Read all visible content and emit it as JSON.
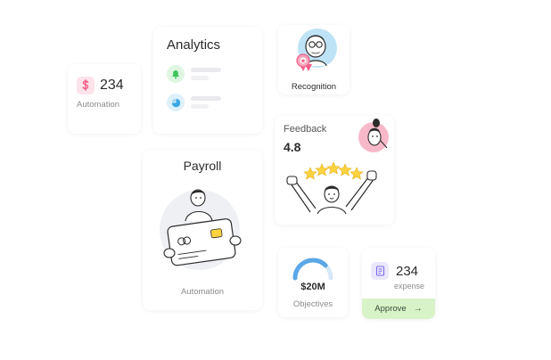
{
  "automation_card": {
    "value": "234",
    "label": "Automation"
  },
  "analytics_card": {
    "title": "Analytics"
  },
  "recognition_card": {
    "label": "Recognition"
  },
  "feedback_card": {
    "title": "Feedback",
    "score": "4.8"
  },
  "payroll_card": {
    "title": "Payroll",
    "label": "Automation"
  },
  "objectives_card": {
    "amount": "$20M",
    "label": "Objectives",
    "progress": 0.75
  },
  "expense_card": {
    "value": "234",
    "label": "expense",
    "action": "Approve",
    "action_icon": "arrow-right-icon"
  },
  "colors": {
    "pink_icon_bg": "#fde3ea",
    "pink_icon": "#f35c86",
    "green_icon_bg": "#dff6e2",
    "green_icon": "#3fc35a",
    "blue_icon_bg": "#dff0fb",
    "blue_icon": "#39a7e6",
    "purple_icon_bg": "#ebe8fb",
    "purple_icon": "#7d6cf0",
    "approve_bg": "#d9f3c8",
    "star": "#ffd23f",
    "gauge": "#5aa8e8"
  }
}
